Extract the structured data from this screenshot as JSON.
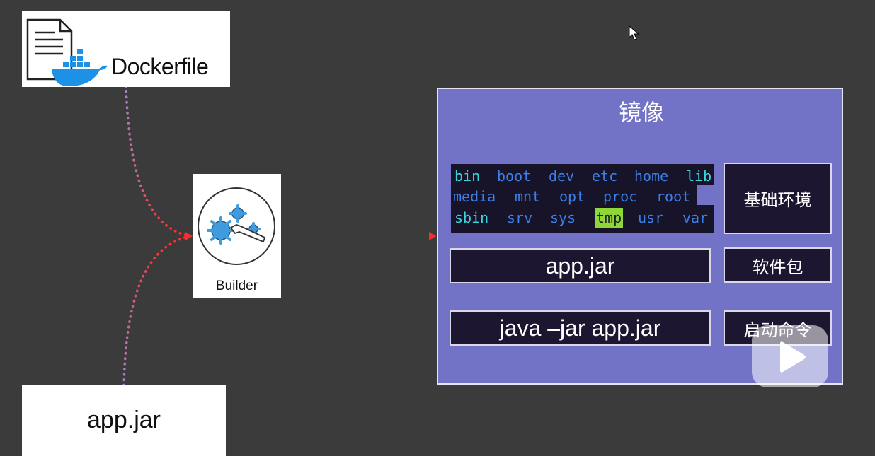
{
  "dockerfile": {
    "label": "Dockerfile",
    "file_icon": "document-icon",
    "whale_icon": "docker-whale-icon"
  },
  "builder": {
    "label": "Builder",
    "icon": "gears-wrench-icon"
  },
  "source_jar": {
    "label": "app.jar"
  },
  "image": {
    "title": "镜像",
    "rootfs": [
      [
        {
          "text": "bin",
          "color": "#39d3dc"
        },
        {
          "text": "boot",
          "color": "#3c7fe6"
        },
        {
          "text": "dev",
          "color": "#3c7fe6"
        },
        {
          "text": "etc",
          "color": "#3c7fe6"
        },
        {
          "text": "home",
          "color": "#3c7fe6"
        },
        {
          "text": "lib",
          "color": "#39d3dc"
        }
      ],
      [
        {
          "text": "media",
          "color": "#3c7fe6"
        },
        {
          "text": "mnt",
          "color": "#3c7fe6"
        },
        {
          "text": "opt",
          "color": "#3c7fe6"
        },
        {
          "text": "proc",
          "color": "#3c7fe6"
        },
        {
          "text": "root",
          "color": "#3c7fe6"
        }
      ],
      [
        {
          "text": "sbin",
          "color": "#39d3dc"
        },
        {
          "text": "srv",
          "color": "#3c7fe6"
        },
        {
          "text": "sys",
          "color": "#3c7fe6"
        },
        {
          "text": "tmp",
          "color": "#1f1f1f",
          "highlight": "#8fd639"
        },
        {
          "text": "usr",
          "color": "#3c7fe6"
        },
        {
          "text": "var",
          "color": "#3c7fe6"
        }
      ]
    ],
    "layers": [
      {
        "content": "app.jar",
        "label": "软件包"
      },
      {
        "content": "java –jar app.jar",
        "label": "启动命令"
      }
    ],
    "base_label": "基础环境"
  },
  "overlay": {
    "icon": "play-icon"
  },
  "cursor": {
    "icon": "mouse-cursor-icon"
  },
  "colors": {
    "background": "#3b3b3b",
    "panel": "#7273c7",
    "box": "#1c1630",
    "connector_purple": "#a77fc8",
    "connector_red": "#ff2a2a"
  }
}
